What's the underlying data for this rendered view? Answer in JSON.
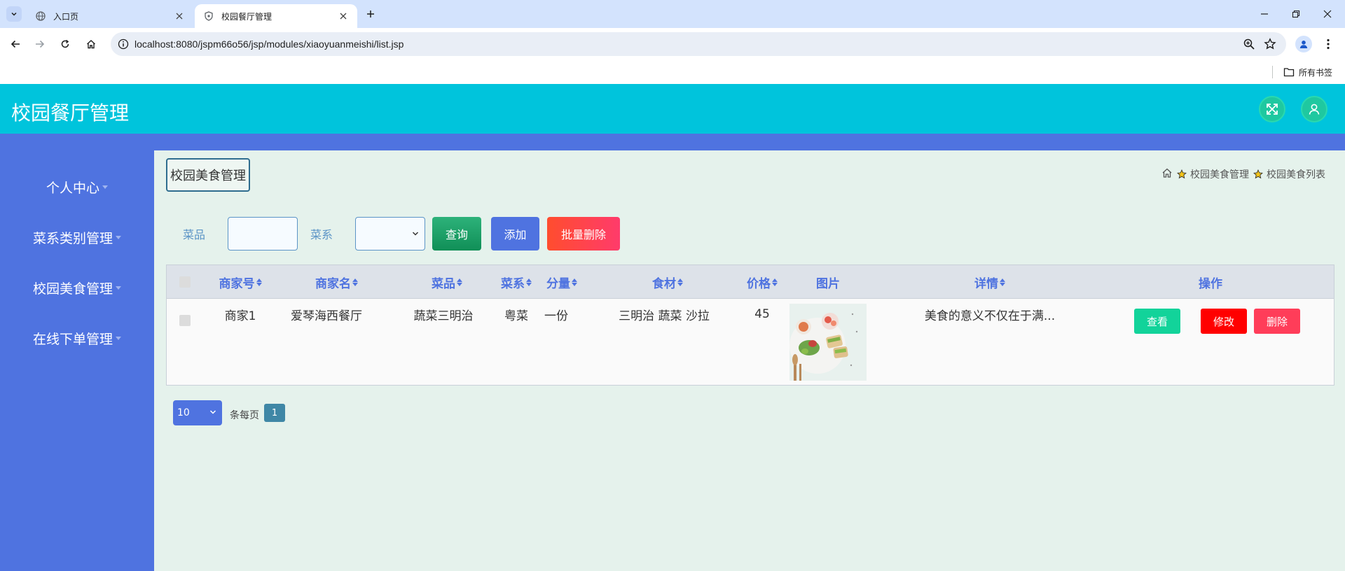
{
  "browser": {
    "tabs": [
      {
        "label": "入口页",
        "active": false
      },
      {
        "label": "校园餐厅管理",
        "active": true
      }
    ],
    "url": "localhost:8080/jspm66o56/jsp/modules/xiaoyuanmeishi/list.jsp",
    "bookmarks_label": "所有书签"
  },
  "app": {
    "title": "校园餐厅管理",
    "header_icons": [
      "fullscreen-icon",
      "user-icon"
    ],
    "colors": {
      "header": "#00c4dc",
      "sidebar": "#4f73e0",
      "main_bg": "#e5f2ec"
    }
  },
  "sidebar": {
    "items": [
      {
        "label": "个人中心"
      },
      {
        "label": "菜系类别管理"
      },
      {
        "label": "校园美食管理"
      },
      {
        "label": "在线下单管理"
      }
    ]
  },
  "content": {
    "section_title": "校园美食管理",
    "breadcrumb": [
      "校园美食管理",
      "校园美食列表"
    ],
    "search": {
      "dish_label": "菜品",
      "dish_value": "",
      "cuisine_label": "菜系",
      "cuisine_value": ""
    },
    "buttons": {
      "query": "查询",
      "add": "添加",
      "bulk_delete": "批量删除"
    }
  },
  "table": {
    "columns": [
      "商家号",
      "商家名",
      "菜品",
      "菜系",
      "分量",
      "食材",
      "价格",
      "图片",
      "详情",
      "操作"
    ],
    "rows": [
      {
        "merchant_no": "商家1",
        "merchant_name": "爱琴海西餐厅",
        "dish": "蔬菜三明治",
        "cuisine": "粤菜",
        "portion": "一份",
        "ingredients": "三明治 蔬菜 沙拉",
        "price": "45",
        "detail": "美食的意义不仅在于满...",
        "actions": {
          "view": "查看",
          "edit": "修改",
          "delete": "删除"
        }
      }
    ]
  },
  "pagination": {
    "page_size": "10",
    "per_page_label": "条每页",
    "current_page": "1"
  }
}
